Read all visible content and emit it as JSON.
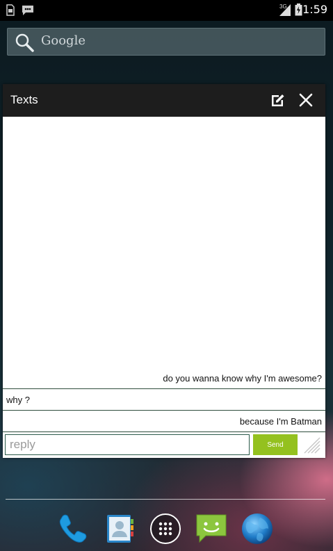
{
  "status_bar": {
    "time": "1:59",
    "network": "3G",
    "icons": [
      "sd-card-icon",
      "sms-notification-icon",
      "signal-icon",
      "battery-icon"
    ]
  },
  "search": {
    "label": "Google"
  },
  "popup": {
    "title": "Texts",
    "messages": [
      {
        "text": "do you wanna know why I'm awesome?",
        "side": "right"
      },
      {
        "text": "why ?",
        "side": "left"
      },
      {
        "text": "because I'm Batman",
        "side": "right"
      }
    ],
    "reply_placeholder": "reply",
    "send_label": "Send"
  },
  "dock": {
    "apps": [
      "phone-icon",
      "contacts-icon",
      "app-drawer-icon",
      "messaging-icon",
      "browser-icon"
    ]
  },
  "colors": {
    "accent_green": "#94c11f",
    "header_bg": "#1d1d1d",
    "divider": "#2e4d3c"
  }
}
